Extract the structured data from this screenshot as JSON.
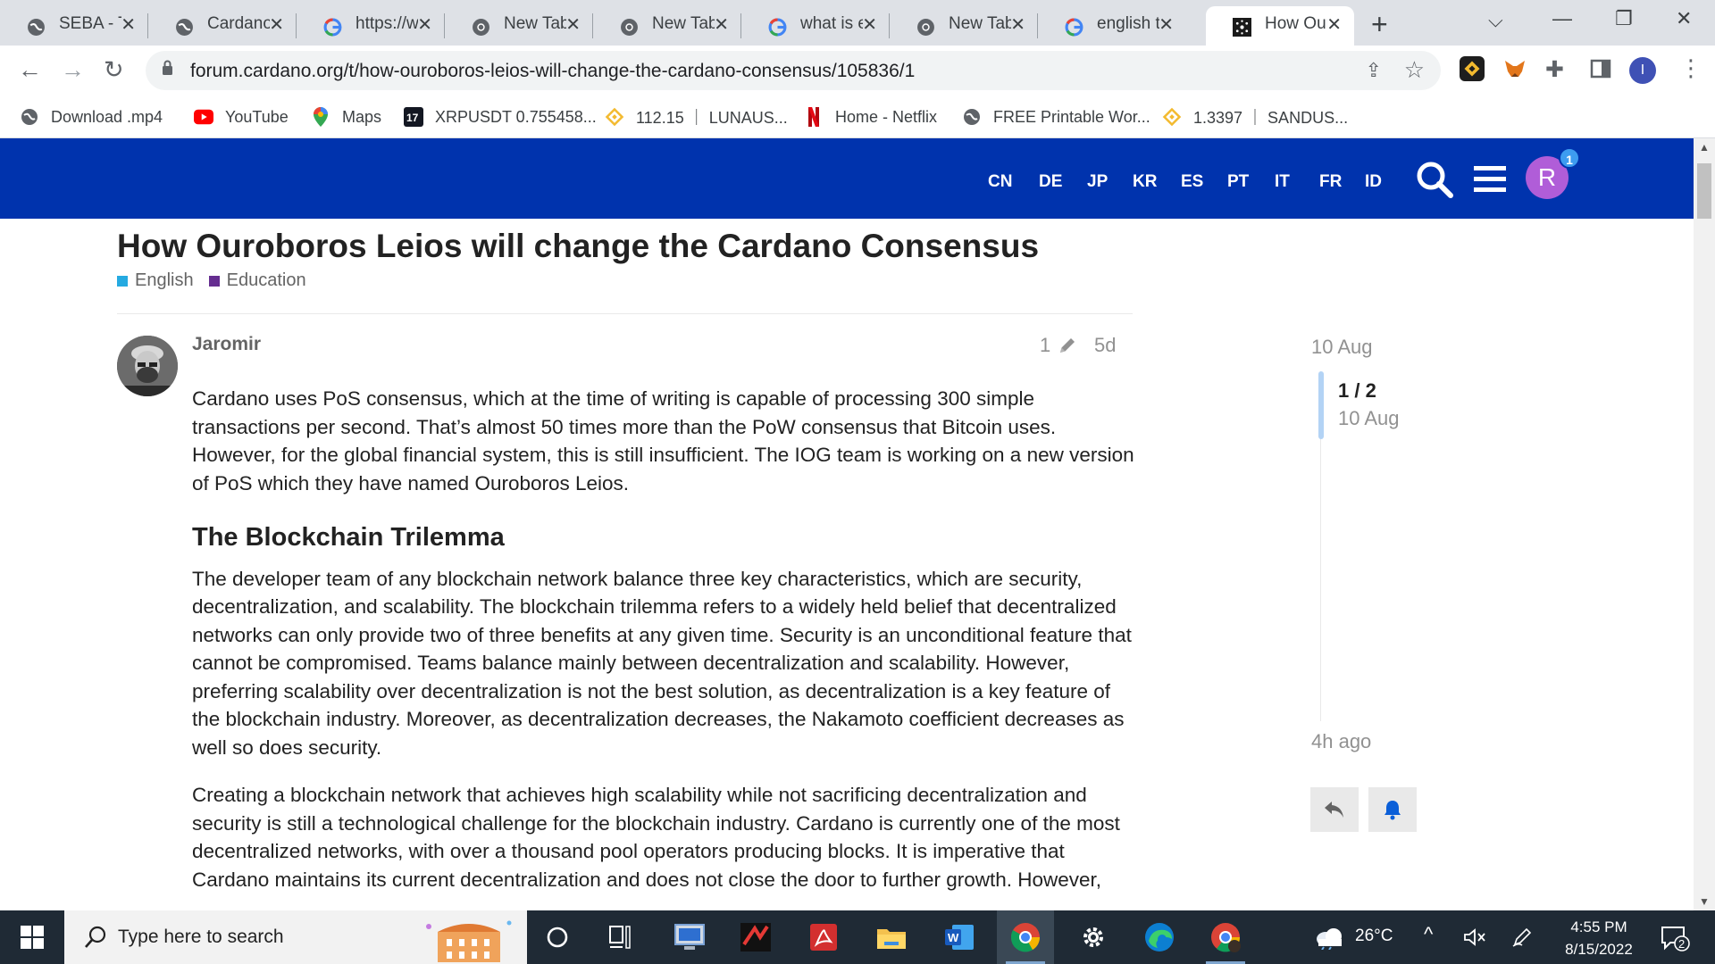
{
  "browser": {
    "tabs": [
      {
        "title": "SEBA - Th",
        "favicon": "globe-icon"
      },
      {
        "title": "Cardano",
        "favicon": "globe-icon"
      },
      {
        "title": "https://w",
        "favicon": "google-icon"
      },
      {
        "title": "New Tab",
        "favicon": "chrome-icon"
      },
      {
        "title": "New Tab",
        "favicon": "chrome-icon"
      },
      {
        "title": "what is e",
        "favicon": "google-icon"
      },
      {
        "title": "New Tab",
        "favicon": "chrome-icon"
      },
      {
        "title": "english t",
        "favicon": "google-icon"
      },
      {
        "title": "How Our",
        "favicon": "cardano-icon",
        "active": true
      }
    ],
    "url": "forum.cardano.org/t/how-ouroboros-leios-will-change-the-cardano-consensus/105836/1",
    "profile_initial": "I",
    "bookmarks": [
      {
        "label": "Download .mp4",
        "icon": "globe-icon"
      },
      {
        "label": "YouTube",
        "icon": "youtube-icon"
      },
      {
        "label": "Maps",
        "icon": "maps-icon"
      },
      {
        "label": "XRPUSDT 0.755458...",
        "icon": "tradingview-icon"
      },
      {
        "label": "112.15 ｜ LUNAUS...",
        "icon": "binance-icon"
      },
      {
        "label": "Home - Netflix",
        "icon": "netflix-icon"
      },
      {
        "label": "FREE Printable Wor...",
        "icon": "globe-icon"
      },
      {
        "label": "1.3397 ｜ SANDUS...",
        "icon": "binance-icon"
      }
    ]
  },
  "header": {
    "languages": [
      "CN",
      "DE",
      "JP",
      "KR",
      "ES",
      "PT",
      "IT",
      "FR",
      "ID"
    ],
    "user_initial": "R",
    "notification_count": "1"
  },
  "topic": {
    "title": "How Ouroboros Leios will change the Cardano Consensus",
    "categories": [
      {
        "name": "English",
        "color": "#25aae1"
      },
      {
        "name": "Education",
        "color": "#652d90"
      }
    ]
  },
  "post": {
    "username": "Jaromir",
    "edit_count": "1",
    "age": "5d",
    "paragraph_1": "Cardano uses PoS consensus, which at the time of writing is capable of processing 300 simple transactions per second. That’s almost 50 times more than the PoW consensus that Bitcoin uses. However, for the global financial system, this is still insufficient. The IOG team is working on a new version of PoS which they have named Ouroboros Leios.",
    "heading_1": "The Blockchain Trilemma",
    "paragraph_2": "The developer team of any blockchain network balance three key characteristics, which are security, decentralization, and scalability. The blockchain trilemma refers to a widely held belief that decentralized networks can only provide two of three benefits at any given time. Security is an unconditional feature that cannot be compromised. Teams balance mainly between decentralization and scalability. However, preferring scalability over decentralization is not the best solution, as decentralization is a key feature of the blockchain industry. Moreover, as decentralization decreases, the Nakamoto coefficient decreases as well so does security.",
    "paragraph_3": "Creating a blockchain network that achieves high scalability while not sacrificing decentralization and security is still a technological challenge for the blockchain industry. Cardano is currently one of the most decentralized networks, with over a thousand pool operators producing blocks. It is imperative that Cardano maintains its current decentralization and does not close the door to further growth. However,"
  },
  "timeline": {
    "start_date": "10 Aug",
    "position": "1 / 2",
    "position_date": "10 Aug",
    "last_activity": "4h ago"
  },
  "taskbar": {
    "search_placeholder": "Type here to search",
    "weather": "26°C",
    "time": "4:55 PM",
    "date": "8/15/2022",
    "notification_count": "2"
  },
  "colors": {
    "header_bg": "#0033ad",
    "avatar_bg": "#b05dd8",
    "badge_bg": "#3d9cf0",
    "timeline_handle": "#b3d3f5"
  }
}
